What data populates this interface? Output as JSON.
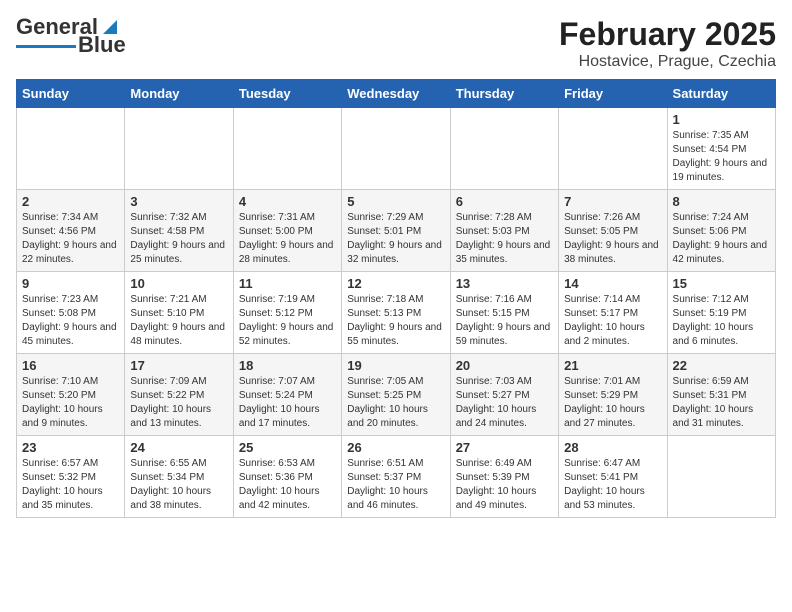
{
  "header": {
    "logo_general": "General",
    "logo_blue": "Blue",
    "title": "February 2025",
    "subtitle": "Hostavice, Prague, Czechia"
  },
  "weekdays": [
    "Sunday",
    "Monday",
    "Tuesday",
    "Wednesday",
    "Thursday",
    "Friday",
    "Saturday"
  ],
  "weeks": [
    [
      {
        "num": "",
        "info": ""
      },
      {
        "num": "",
        "info": ""
      },
      {
        "num": "",
        "info": ""
      },
      {
        "num": "",
        "info": ""
      },
      {
        "num": "",
        "info": ""
      },
      {
        "num": "",
        "info": ""
      },
      {
        "num": "1",
        "info": "Sunrise: 7:35 AM\nSunset: 4:54 PM\nDaylight: 9 hours and 19 minutes."
      }
    ],
    [
      {
        "num": "2",
        "info": "Sunrise: 7:34 AM\nSunset: 4:56 PM\nDaylight: 9 hours and 22 minutes."
      },
      {
        "num": "3",
        "info": "Sunrise: 7:32 AM\nSunset: 4:58 PM\nDaylight: 9 hours and 25 minutes."
      },
      {
        "num": "4",
        "info": "Sunrise: 7:31 AM\nSunset: 5:00 PM\nDaylight: 9 hours and 28 minutes."
      },
      {
        "num": "5",
        "info": "Sunrise: 7:29 AM\nSunset: 5:01 PM\nDaylight: 9 hours and 32 minutes."
      },
      {
        "num": "6",
        "info": "Sunrise: 7:28 AM\nSunset: 5:03 PM\nDaylight: 9 hours and 35 minutes."
      },
      {
        "num": "7",
        "info": "Sunrise: 7:26 AM\nSunset: 5:05 PM\nDaylight: 9 hours and 38 minutes."
      },
      {
        "num": "8",
        "info": "Sunrise: 7:24 AM\nSunset: 5:06 PM\nDaylight: 9 hours and 42 minutes."
      }
    ],
    [
      {
        "num": "9",
        "info": "Sunrise: 7:23 AM\nSunset: 5:08 PM\nDaylight: 9 hours and 45 minutes."
      },
      {
        "num": "10",
        "info": "Sunrise: 7:21 AM\nSunset: 5:10 PM\nDaylight: 9 hours and 48 minutes."
      },
      {
        "num": "11",
        "info": "Sunrise: 7:19 AM\nSunset: 5:12 PM\nDaylight: 9 hours and 52 minutes."
      },
      {
        "num": "12",
        "info": "Sunrise: 7:18 AM\nSunset: 5:13 PM\nDaylight: 9 hours and 55 minutes."
      },
      {
        "num": "13",
        "info": "Sunrise: 7:16 AM\nSunset: 5:15 PM\nDaylight: 9 hours and 59 minutes."
      },
      {
        "num": "14",
        "info": "Sunrise: 7:14 AM\nSunset: 5:17 PM\nDaylight: 10 hours and 2 minutes."
      },
      {
        "num": "15",
        "info": "Sunrise: 7:12 AM\nSunset: 5:19 PM\nDaylight: 10 hours and 6 minutes."
      }
    ],
    [
      {
        "num": "16",
        "info": "Sunrise: 7:10 AM\nSunset: 5:20 PM\nDaylight: 10 hours and 9 minutes."
      },
      {
        "num": "17",
        "info": "Sunrise: 7:09 AM\nSunset: 5:22 PM\nDaylight: 10 hours and 13 minutes."
      },
      {
        "num": "18",
        "info": "Sunrise: 7:07 AM\nSunset: 5:24 PM\nDaylight: 10 hours and 17 minutes."
      },
      {
        "num": "19",
        "info": "Sunrise: 7:05 AM\nSunset: 5:25 PM\nDaylight: 10 hours and 20 minutes."
      },
      {
        "num": "20",
        "info": "Sunrise: 7:03 AM\nSunset: 5:27 PM\nDaylight: 10 hours and 24 minutes."
      },
      {
        "num": "21",
        "info": "Sunrise: 7:01 AM\nSunset: 5:29 PM\nDaylight: 10 hours and 27 minutes."
      },
      {
        "num": "22",
        "info": "Sunrise: 6:59 AM\nSunset: 5:31 PM\nDaylight: 10 hours and 31 minutes."
      }
    ],
    [
      {
        "num": "23",
        "info": "Sunrise: 6:57 AM\nSunset: 5:32 PM\nDaylight: 10 hours and 35 minutes."
      },
      {
        "num": "24",
        "info": "Sunrise: 6:55 AM\nSunset: 5:34 PM\nDaylight: 10 hours and 38 minutes."
      },
      {
        "num": "25",
        "info": "Sunrise: 6:53 AM\nSunset: 5:36 PM\nDaylight: 10 hours and 42 minutes."
      },
      {
        "num": "26",
        "info": "Sunrise: 6:51 AM\nSunset: 5:37 PM\nDaylight: 10 hours and 46 minutes."
      },
      {
        "num": "27",
        "info": "Sunrise: 6:49 AM\nSunset: 5:39 PM\nDaylight: 10 hours and 49 minutes."
      },
      {
        "num": "28",
        "info": "Sunrise: 6:47 AM\nSunset: 5:41 PM\nDaylight: 10 hours and 53 minutes."
      },
      {
        "num": "",
        "info": ""
      }
    ]
  ]
}
